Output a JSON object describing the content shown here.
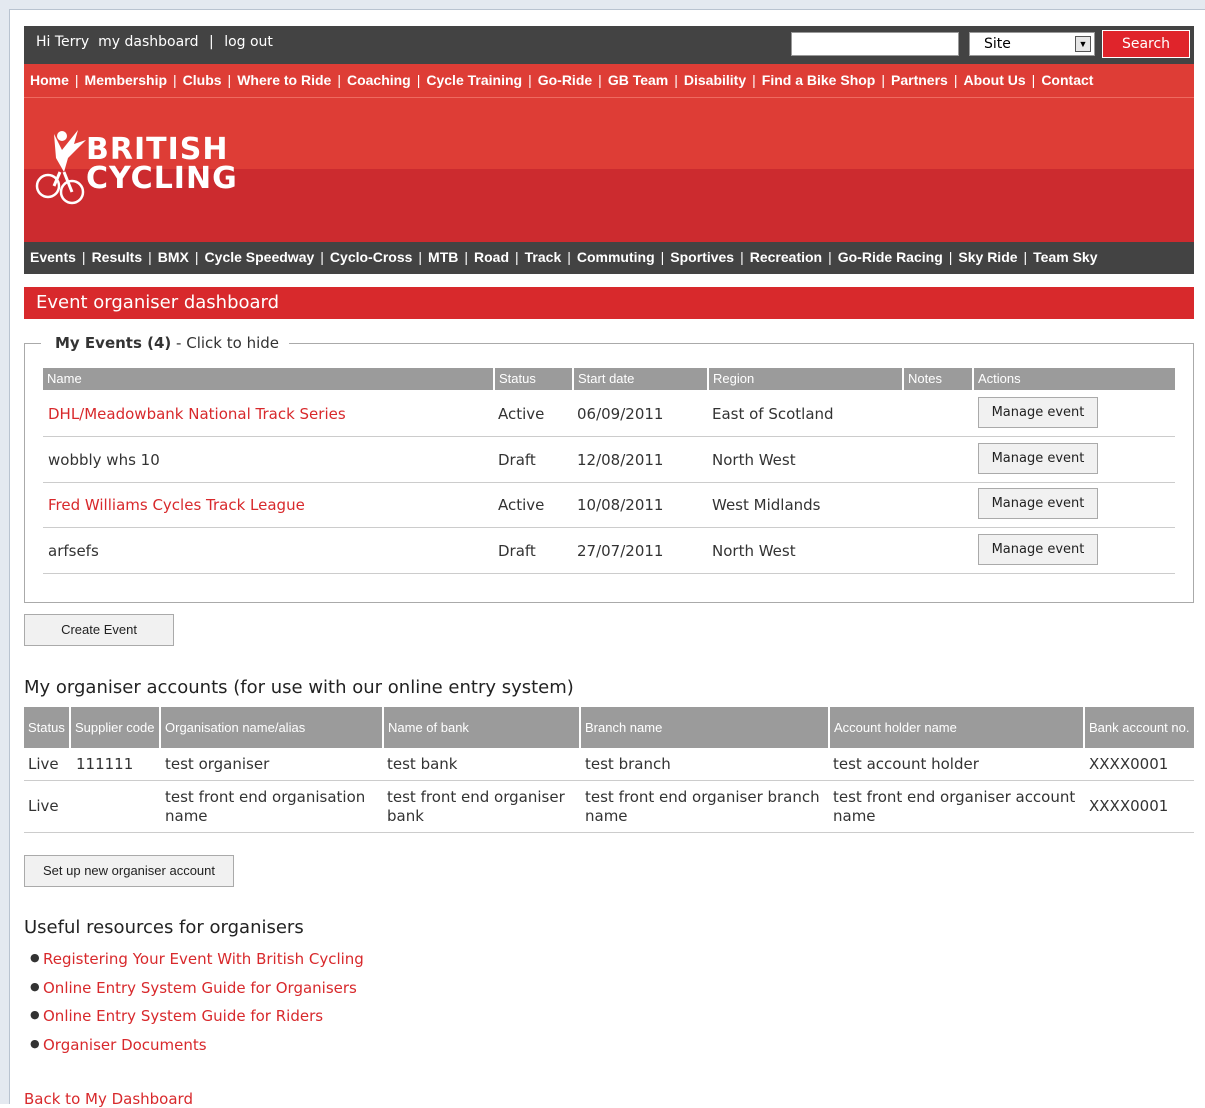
{
  "topbar": {
    "greeting": "Hi Terry",
    "dashboard_link": "my dashboard",
    "separator": "|",
    "logout_link": "log out",
    "search_value": "",
    "site_select": "Site",
    "search_button": "Search"
  },
  "main_nav": [
    "Home",
    "Membership",
    "Clubs",
    "Where to Ride",
    "Coaching",
    "Cycle Training",
    "Go-Ride",
    "GB Team",
    "Disability",
    "Find a Bike Shop",
    "Partners",
    "About Us",
    "Contact"
  ],
  "logo": {
    "line1": "BRITISH",
    "line2": "CYCLING"
  },
  "sub_nav": [
    "Events",
    "Results",
    "BMX",
    "Cycle Speedway",
    "Cyclo-Cross",
    "MTB",
    "Road",
    "Track",
    "Commuting",
    "Sportives",
    "Recreation",
    "Go-Ride Racing",
    "Sky Ride",
    "Team Sky"
  ],
  "page_title": "Event organiser dashboard",
  "my_events": {
    "legend_bold": "My Events (4)",
    "legend_rest": " - Click to hide",
    "columns": [
      "Name",
      "Status",
      "Start date",
      "Region",
      "Notes",
      "Actions"
    ],
    "rows": [
      {
        "name": "DHL/Meadowbank National Track Series",
        "status": "Active",
        "start_date": "06/09/2011",
        "region": "East of Scotland",
        "notes": "",
        "action": "Manage event"
      },
      {
        "name": "wobbly whs 10",
        "status": "Draft",
        "start_date": "12/08/2011",
        "region": "North West",
        "notes": "",
        "action": "Manage event"
      },
      {
        "name": "Fred Williams Cycles Track League",
        "status": "Active",
        "start_date": "10/08/2011",
        "region": "West Midlands",
        "notes": "",
        "action": "Manage event"
      },
      {
        "name": "arfsefs",
        "status": "Draft",
        "start_date": "27/07/2011",
        "region": "North West",
        "notes": "",
        "action": "Manage event"
      }
    ],
    "create_button": "Create Event"
  },
  "accounts": {
    "heading": "My organiser accounts (for use with our online entry system)",
    "columns": [
      "Status",
      "Supplier code",
      "Organisation name/alias",
      "Name of bank",
      "Branch name",
      "Account holder name",
      "Bank account no."
    ],
    "rows": [
      {
        "status": "Live",
        "supplier_code": "111111",
        "org_name": "test organiser",
        "bank": "test bank",
        "branch": "test branch",
        "holder": "test account holder",
        "account_no": "XXXX0001"
      },
      {
        "status": "Live",
        "supplier_code": "",
        "org_name": "test front end organisation name",
        "bank": "test front end organiser bank",
        "branch": "test front end organiser branch name",
        "holder": "test front end organiser account name",
        "account_no": "XXXX0001"
      }
    ],
    "setup_button": "Set up new organiser account"
  },
  "resources": {
    "heading": "Useful resources for organisers",
    "links": [
      "Registering Your Event With British Cycling",
      "Online Entry System Guide for Organisers",
      "Online Entry System Guide for Riders",
      "Organiser Documents"
    ]
  },
  "back_link": "Back to My Dashboard",
  "colors": {
    "brand_red": "#d8292c",
    "dark_bar": "#434343",
    "table_header": "#9b9b9b"
  }
}
